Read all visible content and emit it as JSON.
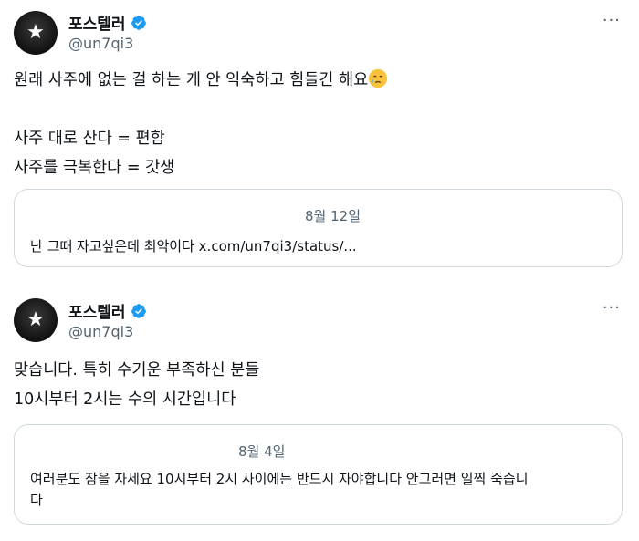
{
  "tweets": [
    {
      "author_name": "포스텔러",
      "handle": "@un7qi3",
      "more_label": "···",
      "lines": [
        "원래 사주에 없는 걸 하는 게 안 익숙하고 힘들긴 해요",
        "",
        "사주 대로 산다 = 편함",
        "사주를 극복한다 = 갓생"
      ],
      "emoji": "crying-face-emoji",
      "quote": {
        "date": "8월 12일",
        "text": "난 그때 자고싶은데 최악이다 x.com/un7qi3/status/..."
      }
    },
    {
      "author_name": "포스텔러",
      "handle": "@un7qi3",
      "more_label": "···",
      "lines": [
        "맞습니다. 특히 수기운 부족하신 분들",
        "10시부터 2시는 수의 시간입니다"
      ],
      "quote": {
        "date": "8월 4일",
        "text_line1": "여러분도 잠을 자세요 10시부터 2시 사이에는 반드시 자야합니다 안그러면 일찍 죽습니",
        "text_line2": "다"
      }
    }
  ],
  "colors": {
    "verified": "#1d9bf0",
    "secondary_text": "#536471",
    "border": "#cfd9de"
  }
}
